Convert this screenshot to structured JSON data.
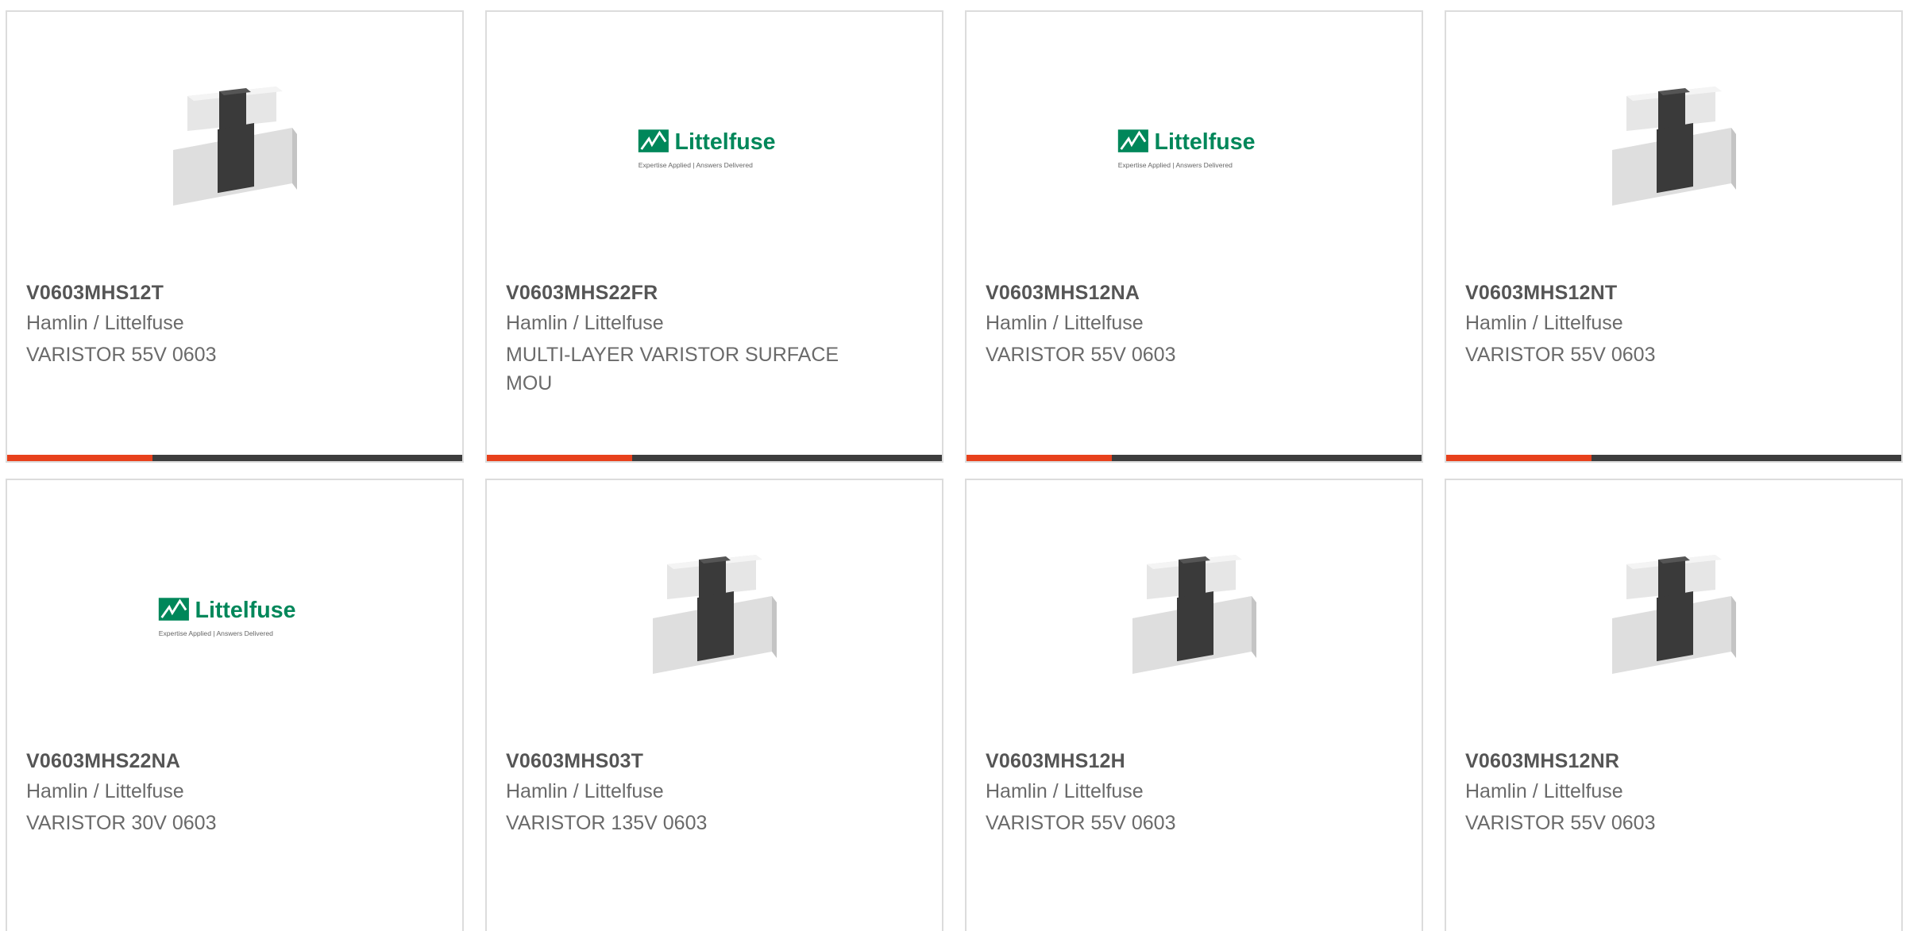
{
  "colors": {
    "accent": "#e8411c",
    "bar_dark": "#3d3d3d",
    "littelfuse_green": "#00875a",
    "text_dark": "#555555",
    "text_light": "#6a6a6a"
  },
  "logo": {
    "word": "Littelfuse",
    "tagline": "Expertise Applied | Answers Delivered"
  },
  "products": [
    {
      "part": "V0603MHS12T",
      "manufacturer": "Hamlin / Littelfuse",
      "description": "VARISTOR 55V 0603",
      "image": "varistor-chip-icon"
    },
    {
      "part": "V0603MHS22FR",
      "manufacturer": "Hamlin / Littelfuse",
      "description": "MULTI-LAYER VARISTOR SURFACE MOU",
      "image": "littelfuse-logo"
    },
    {
      "part": "V0603MHS12NA",
      "manufacturer": "Hamlin / Littelfuse",
      "description": "VARISTOR 55V 0603",
      "image": "littelfuse-logo"
    },
    {
      "part": "V0603MHS12NT",
      "manufacturer": "Hamlin / Littelfuse",
      "description": "VARISTOR 55V 0603",
      "image": "varistor-chip-icon"
    },
    {
      "part": "V0603MHS22NA",
      "manufacturer": "Hamlin / Littelfuse",
      "description": "VARISTOR 30V 0603",
      "image": "littelfuse-logo"
    },
    {
      "part": "V0603MHS03T",
      "manufacturer": "Hamlin / Littelfuse",
      "description": "VARISTOR 135V 0603",
      "image": "varistor-chip-icon"
    },
    {
      "part": "V0603MHS12H",
      "manufacturer": "Hamlin / Littelfuse",
      "description": "VARISTOR 55V 0603",
      "image": "varistor-chip-icon"
    },
    {
      "part": "V0603MHS12NR",
      "manufacturer": "Hamlin / Littelfuse",
      "description": "VARISTOR 55V 0603",
      "image": "varistor-chip-icon"
    }
  ]
}
